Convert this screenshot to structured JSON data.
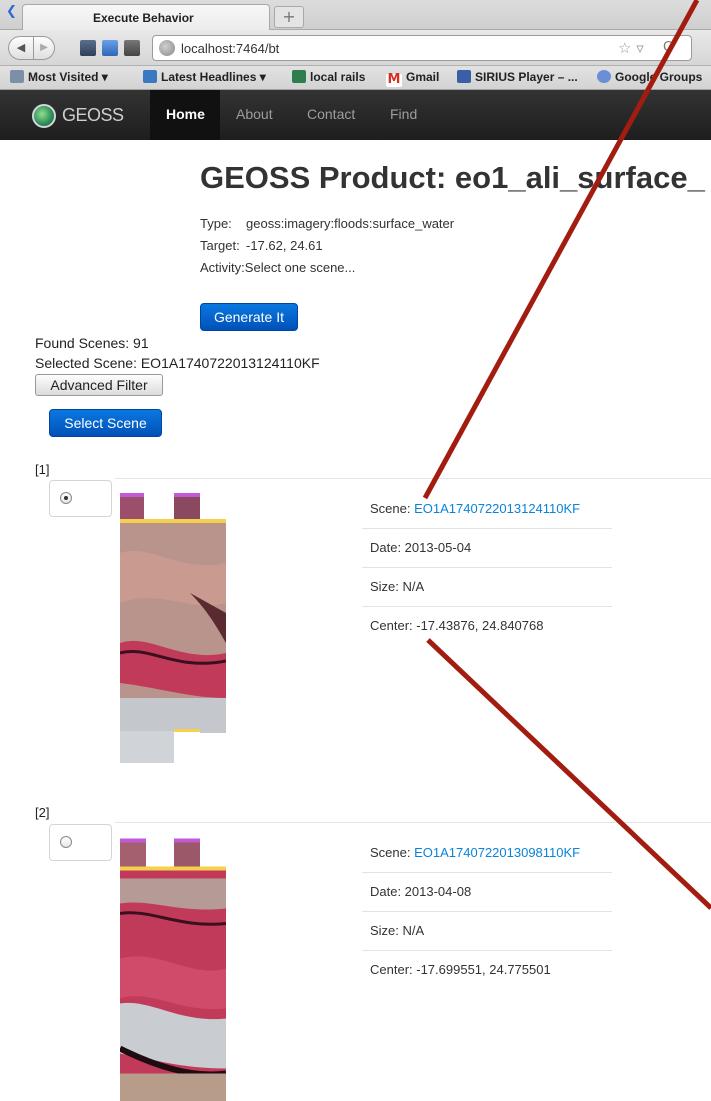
{
  "browser": {
    "tab_title": "Execute Behavior",
    "new_tab": "+",
    "url": "localhost:7464/bt",
    "bookmarks": [
      {
        "label": "Most Visited ▾",
        "icon": "folder-icon",
        "color": "#7d8fa8"
      },
      {
        "label": "Latest Headlines ▾",
        "icon": "rss-icon",
        "color": "#3b78c2"
      },
      {
        "label": "local rails",
        "icon": "rails-icon",
        "color": "#2e7d4f"
      },
      {
        "label": "Gmail",
        "icon": "gmail-icon",
        "color": "#d93025"
      },
      {
        "label": "SIRIUS Player – ...",
        "icon": "sirius-icon",
        "color": "#3a5fa8"
      },
      {
        "label": "Google Groups",
        "icon": "groups-icon",
        "color": "#6b8fd6"
      }
    ]
  },
  "site": {
    "brand": "GEOSS",
    "nav": [
      "Home",
      "About",
      "Contact",
      "Find"
    ],
    "active_nav": "Home"
  },
  "product": {
    "title": "GEOSS Product: eo1_ali_surface_",
    "type_label": "Type:",
    "type_value": "geoss:imagery:floods:surface_water",
    "target_label": "Target:",
    "target_value": "-17.62, 24.61",
    "activity_label": "Activity:",
    "activity_value": "Select one scene...",
    "generate_button": "Generate It"
  },
  "scenes": {
    "found": "Found Scenes: 91",
    "selected": "Selected Scene: EO1A1740722013124110KF",
    "advanced_filter": "Advanced Filter",
    "select_button": "Select Scene",
    "items": [
      {
        "index": "[1]",
        "checked": true,
        "scene_label": "Scene:",
        "scene_id": "EO1A1740722013124110KF",
        "date": "Date: 2013-05-04",
        "size": "Size: N/A",
        "center": "Center: -17.43876, 24.840768"
      },
      {
        "index": "[2]",
        "checked": false,
        "scene_label": "Scene:",
        "scene_id": "EO1A1740722013098110KF",
        "date": "Date: 2013-04-08",
        "size": "Size: N/A",
        "center": "Center: -17.699551, 24.775501"
      }
    ]
  },
  "colors": {
    "link": "#0a83d8",
    "primary_button": "#0a6fd8",
    "navbar": "#222222",
    "annotation_line": "#a21d10"
  }
}
